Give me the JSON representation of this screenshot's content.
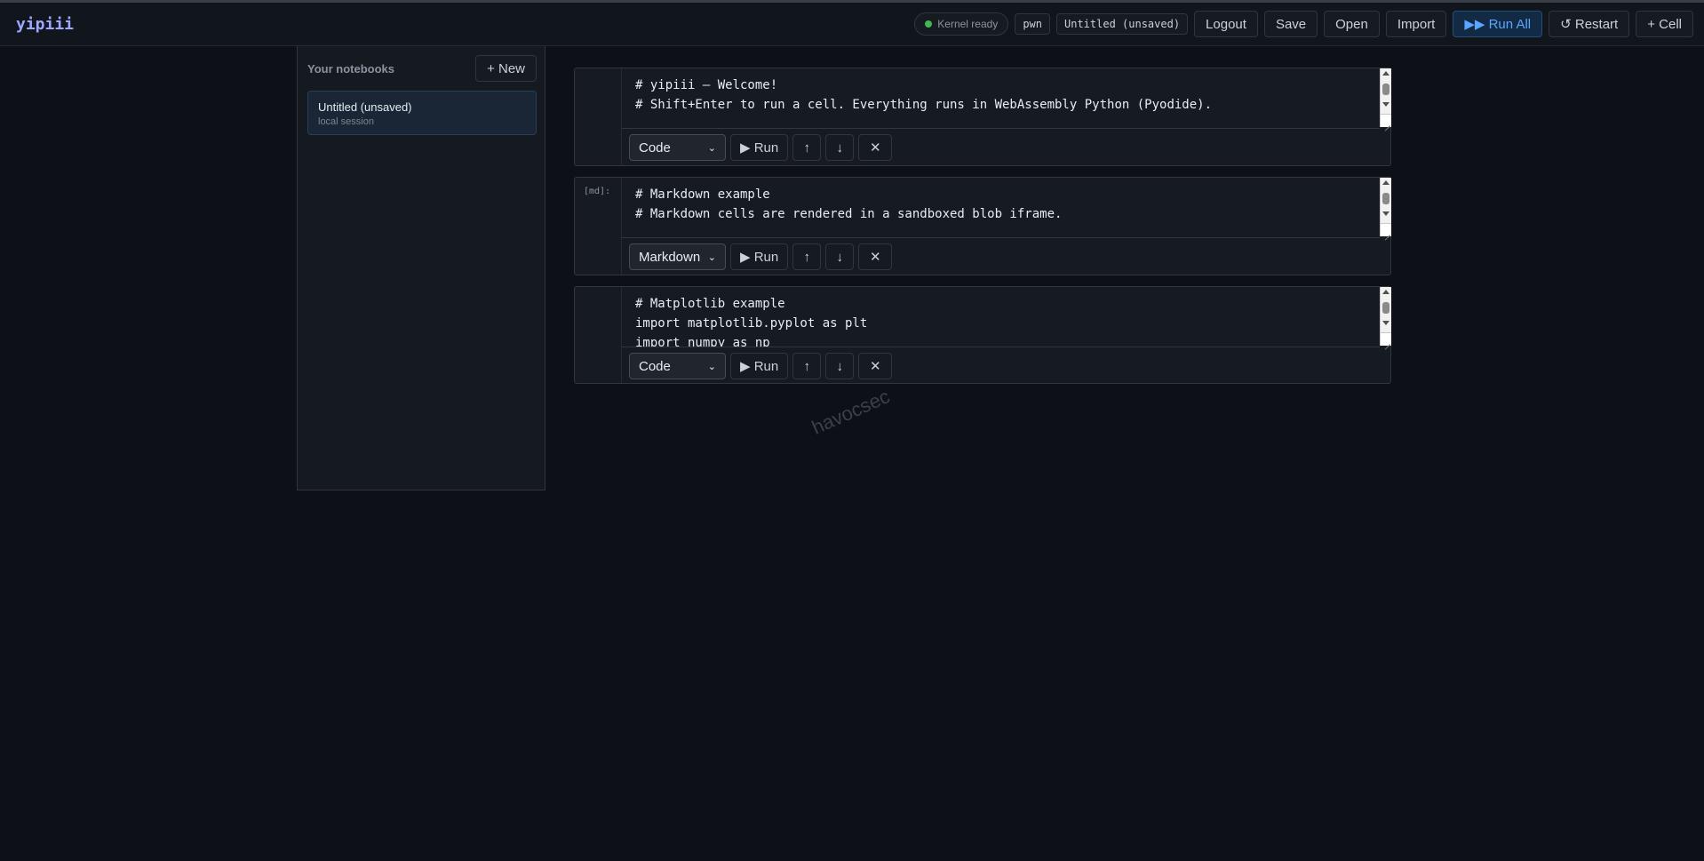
{
  "app": {
    "logo": "yipiii"
  },
  "header": {
    "kernel_status": "Kernel ready",
    "user": "pwn",
    "notebook_name": "Untitled (unsaved)",
    "buttons": {
      "logout": "Logout",
      "save": "Save",
      "open": "Open",
      "import": "Import",
      "run_all": "▶▶ Run All",
      "restart": "↺ Restart",
      "add_cell": "+ Cell"
    }
  },
  "sidebar": {
    "title": "Your notebooks",
    "new_button": "+ New",
    "notebooks": [
      {
        "name": "Untitled (unsaved)",
        "subtitle": "local session"
      }
    ]
  },
  "cell_controls": {
    "run": "▶ Run",
    "move_up": "↑",
    "move_down": "↓",
    "delete": "✕"
  },
  "cells": [
    {
      "prompt": "",
      "type": "Code",
      "lines": [
        "# yipiii — Welcome!",
        "# Shift+Enter to run a cell. Everything runs in WebAssembly Python (Pyodide)."
      ]
    },
    {
      "prompt": "[md]:",
      "type": "Markdown",
      "lines": [
        "# Markdown example",
        "# Markdown cells are rendered in a sandboxed blob iframe."
      ]
    },
    {
      "prompt": "",
      "type": "Code",
      "lines": [
        "# Matplotlib example",
        "import matplotlib.pyplot as plt",
        "import numpy as np"
      ]
    }
  ],
  "watermark": "havocsec"
}
